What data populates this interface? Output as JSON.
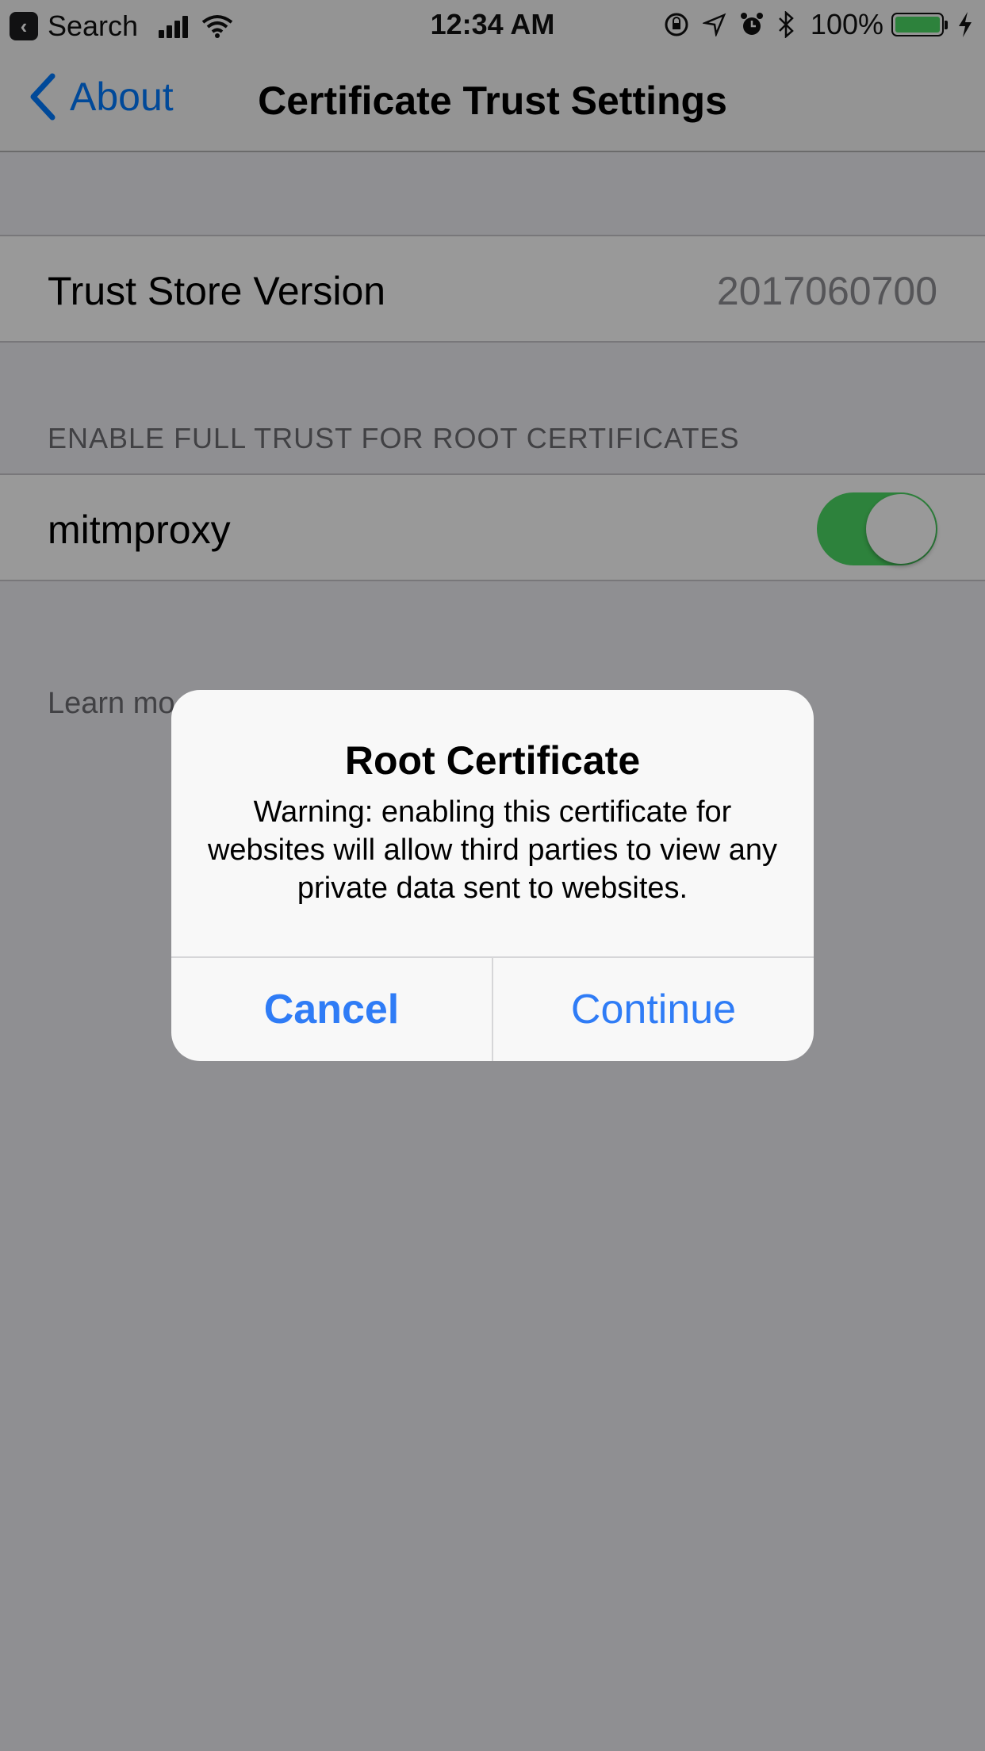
{
  "status_bar": {
    "back_app_label": "Search",
    "time": "12:34 AM",
    "battery_percent": "100%",
    "battery_level": 1.0,
    "icons": [
      "back-app-icon",
      "signal-icon",
      "wifi-icon",
      "rotation-lock-icon",
      "location-icon",
      "alarm-icon",
      "bluetooth-icon",
      "battery-icon",
      "charging-icon"
    ]
  },
  "nav": {
    "back_label": "About",
    "title": "Certificate Trust Settings"
  },
  "trust_store": {
    "label": "Trust Store Version",
    "value": "2017060700"
  },
  "section": {
    "header": "ENABLE FULL TRUST FOR ROOT CERTIFICATES",
    "items": [
      {
        "label": "mitmproxy",
        "enabled": true
      }
    ],
    "footer_visible": "Learn mo"
  },
  "alert": {
    "title": "Root Certificate",
    "message": "Warning: enabling this certificate for websites will allow third parties to view any private data sent to websites.",
    "cancel_label": "Cancel",
    "continue_label": "Continue"
  },
  "colors": {
    "accent": "#2f7cf6",
    "toggle_on": "#4cd964",
    "battery": "#4cd964"
  }
}
